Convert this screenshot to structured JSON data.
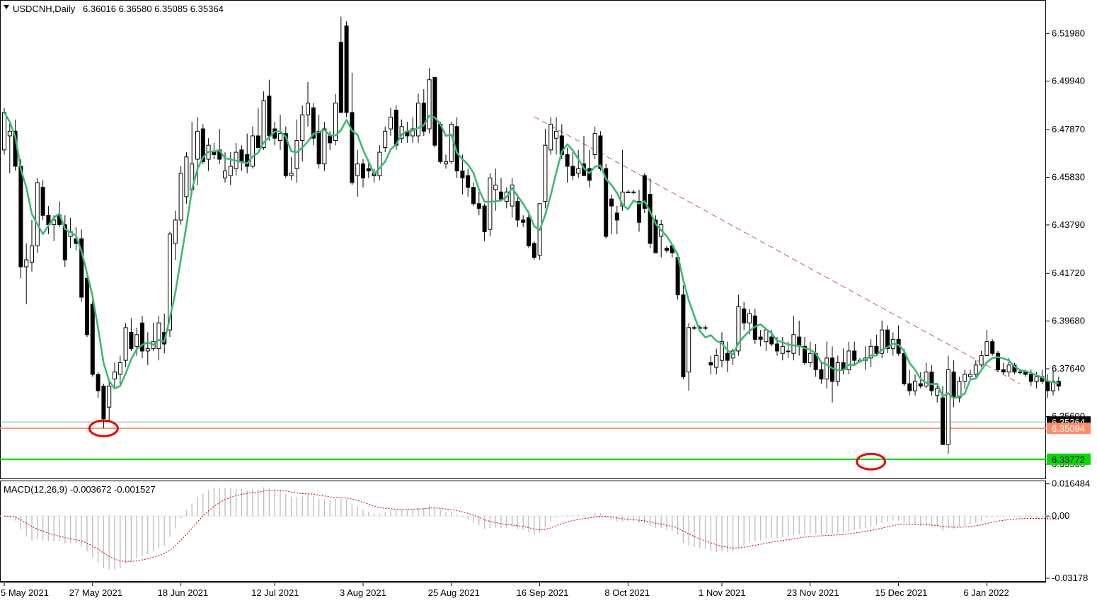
{
  "header": {
    "symbol": "USDCNH,Daily",
    "ohlc": "6.36016 6.36580 6.35085 6.35364",
    "macd_label": "MACD(12,26,9) -0.003672 -0.001527"
  },
  "colors": {
    "ma": "#3cb878",
    "orange_level": "#ff8c66",
    "green_level": "#00dd00",
    "trendline": "#c06060",
    "macd_signal": "#cc0000",
    "macd_hist": "#c0c0c0",
    "marker": "#ee0000"
  },
  "price_axis": {
    "min": 6.3295,
    "max": 6.5335,
    "ticks": [
      {
        "v": 6.5198,
        "t": "6.51980"
      },
      {
        "v": 6.4994,
        "t": "6.49940"
      },
      {
        "v": 6.4787,
        "t": "6.47870"
      },
      {
        "v": 6.4583,
        "t": "6.45830"
      },
      {
        "v": 6.4379,
        "t": "6.43790"
      },
      {
        "v": 6.4172,
        "t": "6.41720"
      },
      {
        "v": 6.3968,
        "t": "6.39680"
      },
      {
        "v": 6.3764,
        "t": "6.37640"
      },
      {
        "v": 6.356,
        "t": "6.35600"
      },
      {
        "v": 6.3356,
        "t": "6.33560"
      }
    ]
  },
  "levels": {
    "current": {
      "v": 6.35364,
      "t": "6.35364"
    },
    "orange": {
      "v": 6.35094,
      "t": "6.35094"
    },
    "green": {
      "v": 6.33772,
      "t": "6.33772"
    }
  },
  "macd_axis": {
    "min": -0.0336,
    "max": 0.0178,
    "ticks": [
      {
        "v": 0.016484,
        "t": "0.016484"
      },
      {
        "v": 0.0,
        "t": "0.00"
      },
      {
        "v": -0.03178,
        "t": "-0.03178"
      }
    ]
  },
  "x_labels": [
    {
      "i": 0,
      "t": "5 May 2021"
    },
    {
      "i": 16,
      "t": "27 May 2021"
    },
    {
      "i": 32,
      "t": "18 Jun 2021"
    },
    {
      "i": 49,
      "t": "12 Jul 2021"
    },
    {
      "i": 65,
      "t": "3 Aug 2021"
    },
    {
      "i": 81,
      "t": "25 Aug 2021"
    },
    {
      "i": 97,
      "t": "16 Sep 2021"
    },
    {
      "i": 113,
      "t": "8 Oct 2021"
    },
    {
      "i": 130,
      "t": "1 Nov 2021"
    },
    {
      "i": 146,
      "t": "23 Nov 2021"
    },
    {
      "i": 162,
      "t": "15 Dec 2021"
    },
    {
      "i": 178,
      "t": "6 Jan 2022"
    }
  ],
  "trendline": {
    "from": {
      "i": 96,
      "p": 6.4842
    },
    "to": {
      "i": 184,
      "p": 6.37
    }
  },
  "markers": [
    {
      "i": 18,
      "p": 6.3509
    },
    {
      "i": 157,
      "p": 6.3367
    }
  ],
  "chart_data": {
    "type": "candlestick",
    "series_name": "USDCNH,Daily",
    "start": "2021-05-05",
    "candles": [
      [
        6.47,
        6.488,
        6.468,
        6.486
      ],
      [
        6.476,
        6.482,
        6.46,
        6.478
      ],
      [
        6.478,
        6.483,
        6.461,
        6.463
      ],
      [
        6.463,
        6.466,
        6.415,
        6.42
      ],
      [
        6.42,
        6.43,
        6.404,
        6.423
      ],
      [
        6.422,
        6.44,
        6.418,
        6.429
      ],
      [
        6.429,
        6.458,
        6.426,
        6.456
      ],
      [
        6.454,
        6.457,
        6.44,
        6.442
      ],
      [
        6.442,
        6.446,
        6.434,
        6.438
      ],
      [
        6.438,
        6.442,
        6.431,
        6.44
      ],
      [
        6.442,
        6.448,
        6.437,
        6.438
      ],
      [
        6.438,
        6.442,
        6.42,
        6.423
      ],
      [
        6.433,
        6.441,
        6.428,
        6.435
      ],
      [
        6.432,
        6.437,
        6.427,
        6.43
      ],
      [
        6.432,
        6.436,
        6.405,
        6.407
      ],
      [
        6.415,
        6.416,
        6.39,
        6.391
      ],
      [
        6.404,
        6.409,
        6.373,
        6.374
      ],
      [
        6.374,
        6.375,
        6.364,
        6.367
      ],
      [
        6.369,
        6.37,
        6.351,
        6.355
      ],
      [
        6.36,
        6.371,
        6.354,
        6.369
      ],
      [
        6.372,
        6.379,
        6.368,
        6.375
      ],
      [
        6.374,
        6.382,
        6.37,
        6.379
      ],
      [
        6.38,
        6.396,
        6.377,
        6.394
      ],
      [
        6.392,
        6.398,
        6.384,
        6.385
      ],
      [
        6.386,
        6.394,
        6.382,
        6.391
      ],
      [
        6.396,
        6.399,
        6.381,
        6.384
      ],
      [
        6.384,
        6.392,
        6.378,
        6.385
      ],
      [
        6.385,
        6.396,
        6.384,
        6.388
      ],
      [
        6.385,
        6.399,
        6.38,
        6.396
      ],
      [
        6.392,
        6.4,
        6.383,
        6.387
      ],
      [
        6.393,
        6.435,
        6.39,
        6.434
      ],
      [
        6.43,
        6.444,
        6.423,
        6.44
      ],
      [
        6.44,
        6.463,
        6.438,
        6.46
      ],
      [
        6.45,
        6.469,
        6.447,
        6.467
      ],
      [
        6.453,
        6.482,
        6.451,
        6.464
      ],
      [
        6.466,
        6.484,
        6.455,
        6.478
      ],
      [
        6.479,
        6.481,
        6.464,
        6.465
      ],
      [
        6.466,
        6.475,
        6.461,
        6.472
      ],
      [
        6.469,
        6.473,
        6.466,
        6.468
      ],
      [
        6.47,
        6.479,
        6.464,
        6.466
      ],
      [
        6.458,
        6.469,
        6.456,
        6.461
      ],
      [
        6.459,
        6.469,
        6.455,
        6.463
      ],
      [
        6.462,
        6.473,
        6.459,
        6.469
      ],
      [
        6.47,
        6.472,
        6.461,
        6.465
      ],
      [
        6.468,
        6.477,
        6.46,
        6.463
      ],
      [
        6.463,
        6.48,
        6.462,
        6.476
      ],
      [
        6.476,
        6.488,
        6.471,
        6.471
      ],
      [
        6.471,
        6.495,
        6.47,
        6.491
      ],
      [
        6.493,
        6.5,
        6.474,
        6.476
      ],
      [
        6.479,
        6.482,
        6.472,
        6.475
      ],
      [
        6.474,
        6.485,
        6.47,
        6.477
      ],
      [
        6.477,
        6.48,
        6.458,
        6.459
      ],
      [
        6.459,
        6.467,
        6.457,
        6.46
      ],
      [
        6.462,
        6.483,
        6.456,
        6.474
      ],
      [
        6.474,
        6.489,
        6.465,
        6.485
      ],
      [
        6.485,
        6.499,
        6.48,
        6.49
      ],
      [
        6.488,
        6.49,
        6.472,
        6.475
      ],
      [
        6.478,
        6.485,
        6.462,
        6.464
      ],
      [
        6.464,
        6.482,
        6.461,
        6.479
      ],
      [
        6.476,
        6.478,
        6.47,
        6.473
      ],
      [
        6.474,
        6.494,
        6.472,
        6.49
      ],
      [
        6.516,
        6.527,
        6.486,
        6.486
      ],
      [
        6.523,
        6.525,
        6.484,
        6.486
      ],
      [
        6.486,
        6.503,
        6.455,
        6.456
      ],
      [
        6.459,
        6.47,
        6.45,
        6.464
      ],
      [
        6.464,
        6.466,
        6.454,
        6.458
      ],
      [
        6.462,
        6.465,
        6.458,
        6.461
      ],
      [
        6.46,
        6.462,
        6.456,
        6.459
      ],
      [
        6.459,
        6.472,
        6.457,
        6.469
      ],
      [
        6.471,
        6.48,
        6.469,
        6.478
      ],
      [
        6.479,
        6.488,
        6.476,
        6.484
      ],
      [
        6.487,
        6.489,
        6.47,
        6.472
      ],
      [
        6.475,
        6.483,
        6.473,
        6.48
      ],
      [
        6.478,
        6.482,
        6.473,
        6.476
      ],
      [
        6.476,
        6.484,
        6.473,
        6.479
      ],
      [
        6.476,
        6.494,
        6.473,
        6.49
      ],
      [
        6.49,
        6.496,
        6.476,
        6.478
      ],
      [
        6.479,
        6.505,
        6.477,
        6.5
      ],
      [
        6.501,
        6.501,
        6.471,
        6.472
      ],
      [
        6.481,
        6.482,
        6.464,
        6.465
      ],
      [
        6.464,
        6.468,
        6.462,
        6.465
      ],
      [
        6.465,
        6.482,
        6.464,
        6.481
      ],
      [
        6.48,
        6.484,
        6.458,
        6.461
      ],
      [
        6.461,
        6.468,
        6.451,
        6.458
      ],
      [
        6.459,
        6.462,
        6.45,
        6.454
      ],
      [
        6.454,
        6.456,
        6.446,
        6.447
      ],
      [
        6.447,
        6.452,
        6.442,
        6.445
      ],
      [
        6.446,
        6.447,
        6.431,
        6.435
      ],
      [
        6.436,
        6.46,
        6.433,
        6.458
      ],
      [
        6.453,
        6.462,
        6.444,
        6.455
      ],
      [
        6.452,
        6.458,
        6.448,
        6.449
      ],
      [
        6.448,
        6.454,
        6.445,
        6.452
      ],
      [
        6.446,
        6.458,
        6.441,
        6.455
      ],
      [
        6.448,
        6.451,
        6.437,
        6.44
      ],
      [
        6.44,
        6.442,
        6.437,
        6.439
      ],
      [
        6.441,
        6.444,
        6.428,
        6.429
      ],
      [
        6.43,
        6.431,
        6.423,
        6.424
      ],
      [
        6.425,
        6.447,
        6.423,
        6.447
      ],
      [
        6.448,
        6.479,
        6.445,
        6.472
      ],
      [
        6.47,
        6.484,
        6.468,
        6.481
      ],
      [
        6.475,
        6.484,
        6.468,
        6.478
      ],
      [
        6.476,
        6.481,
        6.466,
        6.468
      ],
      [
        6.468,
        6.471,
        6.456,
        6.463
      ],
      [
        6.463,
        6.469,
        6.457,
        6.459
      ],
      [
        6.46,
        6.47,
        6.458,
        6.462
      ],
      [
        6.464,
        6.476,
        6.459,
        6.459
      ],
      [
        6.462,
        6.47,
        6.454,
        6.457
      ],
      [
        6.468,
        6.48,
        6.466,
        6.477
      ],
      [
        6.476,
        6.478,
        6.461,
        6.462
      ],
      [
        6.462,
        6.464,
        6.432,
        6.433
      ],
      [
        6.449,
        6.451,
        6.434,
        6.446
      ],
      [
        6.443,
        6.446,
        6.434,
        6.44
      ],
      [
        6.446,
        6.47,
        6.444,
        6.452
      ],
      [
        6.452,
        6.453,
        6.452,
        6.452
      ],
      [
        6.452,
        6.453,
        6.451,
        6.452
      ],
      [
        6.448,
        6.453,
        6.435,
        6.439
      ],
      [
        6.459,
        6.46,
        6.443,
        6.445
      ],
      [
        6.451,
        6.458,
        6.428,
        6.43
      ],
      [
        6.44,
        6.442,
        6.426,
        6.426
      ],
      [
        6.433,
        6.44,
        6.424,
        6.438
      ],
      [
        6.428,
        6.429,
        6.426,
        6.427
      ],
      [
        6.429,
        6.429,
        6.424,
        6.426
      ],
      [
        6.424,
        6.426,
        6.406,
        6.408
      ],
      [
        6.408,
        6.412,
        6.372,
        6.373
      ],
      [
        6.375,
        6.396,
        6.367,
        6.394
      ],
      [
        6.394,
        6.395,
        6.393,
        6.394
      ],
      [
        6.394,
        6.395,
        6.393,
        6.394
      ],
      [
        6.394,
        6.395,
        6.393,
        6.394
      ],
      [
        6.379,
        6.382,
        6.374,
        6.378
      ],
      [
        6.377,
        6.385,
        6.374,
        6.382
      ],
      [
        6.38,
        6.392,
        6.377,
        6.388
      ],
      [
        6.383,
        6.388,
        6.375,
        6.38
      ],
      [
        6.381,
        6.385,
        6.378,
        6.384
      ],
      [
        6.384,
        6.408,
        6.382,
        6.403
      ],
      [
        6.402,
        6.405,
        6.393,
        6.396
      ],
      [
        6.396,
        6.402,
        6.391,
        6.4
      ],
      [
        6.399,
        6.402,
        6.387,
        6.389
      ],
      [
        6.39,
        6.393,
        6.386,
        6.389
      ],
      [
        6.388,
        6.394,
        6.384,
        6.393
      ],
      [
        6.39,
        6.393,
        6.386,
        6.387
      ],
      [
        6.387,
        6.39,
        6.382,
        6.384
      ],
      [
        6.383,
        6.39,
        6.38,
        6.386
      ],
      [
        6.384,
        6.388,
        6.381,
        6.384
      ],
      [
        6.383,
        6.399,
        6.38,
        6.391
      ],
      [
        6.39,
        6.397,
        6.382,
        6.386
      ],
      [
        6.386,
        6.39,
        6.378,
        6.379
      ],
      [
        6.379,
        6.388,
        6.377,
        6.383
      ],
      [
        6.383,
        6.387,
        6.373,
        6.376
      ],
      [
        6.376,
        6.379,
        6.37,
        6.372
      ],
      [
        6.372,
        6.388,
        6.368,
        6.381
      ],
      [
        6.381,
        6.386,
        6.362,
        6.371
      ],
      [
        6.371,
        6.382,
        6.369,
        6.379
      ],
      [
        6.379,
        6.385,
        6.374,
        6.376
      ],
      [
        6.376,
        6.388,
        6.374,
        6.384
      ],
      [
        6.384,
        6.388,
        6.378,
        6.38
      ],
      [
        6.38,
        6.381,
        6.379,
        6.38
      ],
      [
        6.38,
        6.386,
        6.376,
        6.381
      ],
      [
        6.381,
        6.389,
        6.377,
        6.386
      ],
      [
        6.386,
        6.391,
        6.382,
        6.383
      ],
      [
        6.383,
        6.397,
        6.381,
        6.393
      ],
      [
        6.393,
        6.395,
        6.383,
        6.385
      ],
      [
        6.385,
        6.392,
        6.382,
        6.389
      ],
      [
        6.389,
        6.395,
        6.382,
        6.383
      ],
      [
        6.383,
        6.385,
        6.369,
        6.37
      ],
      [
        6.37,
        6.376,
        6.365,
        6.367
      ],
      [
        6.367,
        6.374,
        6.365,
        6.371
      ],
      [
        6.37,
        6.375,
        6.368,
        6.369
      ],
      [
        6.369,
        6.379,
        6.368,
        6.375
      ],
      [
        6.375,
        6.378,
        6.365,
        6.367
      ],
      [
        6.365,
        6.37,
        6.362,
        6.368
      ],
      [
        6.364,
        6.369,
        6.344,
        6.344
      ],
      [
        6.344,
        6.382,
        6.34,
        6.376
      ],
      [
        6.375,
        6.38,
        6.36,
        6.364
      ],
      [
        6.364,
        6.373,
        6.362,
        6.371
      ],
      [
        6.371,
        6.376,
        6.368,
        6.374
      ],
      [
        6.373,
        6.376,
        6.371,
        6.374
      ],
      [
        6.374,
        6.38,
        6.372,
        6.378
      ],
      [
        6.378,
        6.384,
        6.377,
        6.382
      ],
      [
        6.382,
        6.393,
        6.382,
        6.388
      ],
      [
        6.388,
        6.389,
        6.382,
        6.383
      ],
      [
        6.383,
        6.384,
        6.375,
        6.376
      ],
      [
        6.376,
        6.379,
        6.374,
        6.375
      ],
      [
        6.375,
        6.381,
        6.373,
        6.378
      ],
      [
        6.378,
        6.379,
        6.374,
        6.375
      ],
      [
        6.375,
        6.376,
        6.374,
        6.375
      ],
      [
        6.375,
        6.376,
        6.373,
        6.374
      ],
      [
        6.374,
        6.376,
        6.369,
        6.371
      ],
      [
        6.371,
        6.375,
        6.368,
        6.373
      ],
      [
        6.373,
        6.376,
        6.37,
        6.371
      ],
      [
        6.371,
        6.374,
        6.364,
        6.367
      ],
      [
        6.367,
        6.376,
        6.365,
        6.371
      ],
      [
        6.371,
        6.373,
        6.367,
        6.369
      ]
    ]
  }
}
